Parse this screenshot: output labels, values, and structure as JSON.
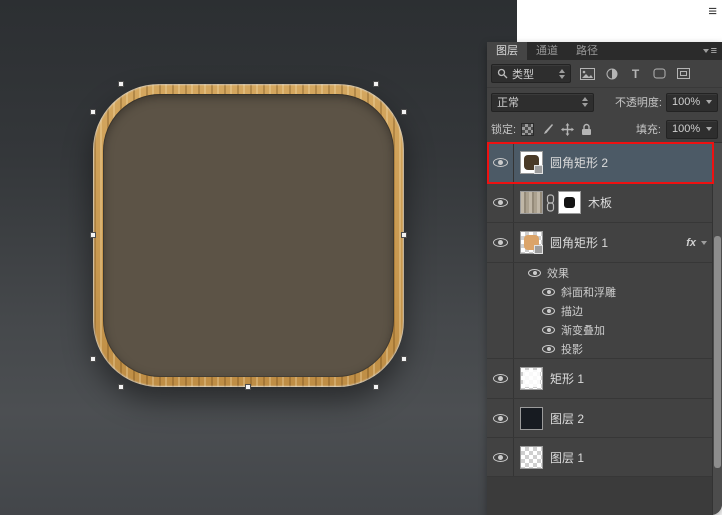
{
  "page": {
    "corner_icon": "≡"
  },
  "icons": {
    "panel_menu": "≡",
    "type_filter": "T"
  },
  "panel": {
    "tabs": [
      {
        "label": "图层"
      },
      {
        "label": "通道"
      },
      {
        "label": "路径"
      }
    ],
    "filter": {
      "kind": "类型"
    },
    "blend": {
      "mode": "正常",
      "opacity_label": "不透明度:",
      "opacity_value": "100%"
    },
    "lock": {
      "label": "锁定:",
      "fill_label": "填充:",
      "fill_value": "100%"
    },
    "fx_label": "fx",
    "layers": [
      {
        "name": "圆角矩形 2",
        "selected": true
      },
      {
        "name": "木板"
      },
      {
        "name": "圆角矩形 1",
        "has_effects": true
      },
      {
        "name": "矩形 1"
      },
      {
        "name": "图层 2"
      },
      {
        "name": "图层 1"
      }
    ],
    "effects": {
      "header": "效果",
      "items": [
        "斜面和浮雕",
        "描边",
        "渐变叠加",
        "投影"
      ]
    }
  },
  "colors": {
    "selection": "#4c5a66",
    "annotation": "#ee1111",
    "icon_frame_wood": "#c9984f",
    "icon_fill": "#5c5346",
    "canvas_top": "#2c2f32",
    "canvas_bottom": "#43464a"
  }
}
